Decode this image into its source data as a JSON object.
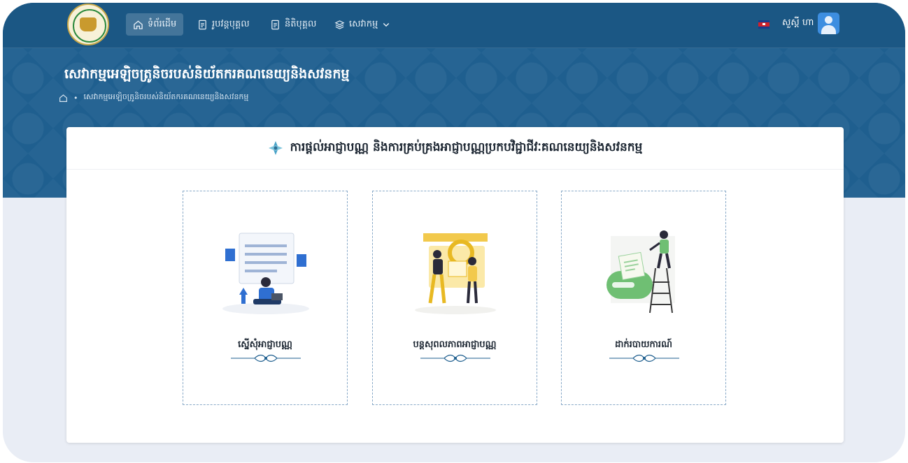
{
  "nav": {
    "items": [
      {
        "label": "ទំព័រដើម",
        "icon": "home-icon"
      },
      {
        "label": "រូបវន្តបុគ្គល",
        "icon": "document-icon"
      },
      {
        "label": "និតិបុគ្គល",
        "icon": "document-icon"
      },
      {
        "label": "សេវាកម្ម",
        "icon": "layers-icon",
        "dropdown_icon": "chevron-down-icon"
      }
    ],
    "user_name": "សួស្តី ហា",
    "flag": "cambodia-flag-icon",
    "avatar": "user-avatar-icon"
  },
  "header": {
    "title": "សេវាកម្មអេឡិចត្រូនិចរបស់និយ័តករគណនេយ្យនិងសវនកម្ម",
    "breadcrumb": {
      "home_icon": "home-icon",
      "separator": "•",
      "current": "សេវាកម្មអេឡិចត្រូនិចរបស់និយ័តករគណនេយ្យនិងសវនកម្ម"
    }
  },
  "card": {
    "title": "ការផ្ដល់អាជ្ញាបណ្ណ និងការគ្រប់គ្រងអាជ្ញាបណ្ណប្រកបវិជ្ជាជីវៈគណនេយ្យនិងសវនកម្ម",
    "title_icon": "diamond-ornament-icon",
    "services": [
      {
        "label": "ស្នើសុំអាជ្ញាបណ្ណ",
        "icon": "apply-license-illustration"
      },
      {
        "label": "បន្តសុពលភាពអាជ្ញាបណ្ណ",
        "icon": "renew-license-illustration"
      },
      {
        "label": "ដាក់របាយការណ៍",
        "icon": "submit-report-illustration"
      }
    ]
  },
  "colors": {
    "banner": "#1f5f8f",
    "navbar": "#1b5784",
    "page_bg": "#e9edf5",
    "card_border": "#88a9c8",
    "accent_yellow": "#f2c94c",
    "accent_green": "#6fbf73"
  }
}
